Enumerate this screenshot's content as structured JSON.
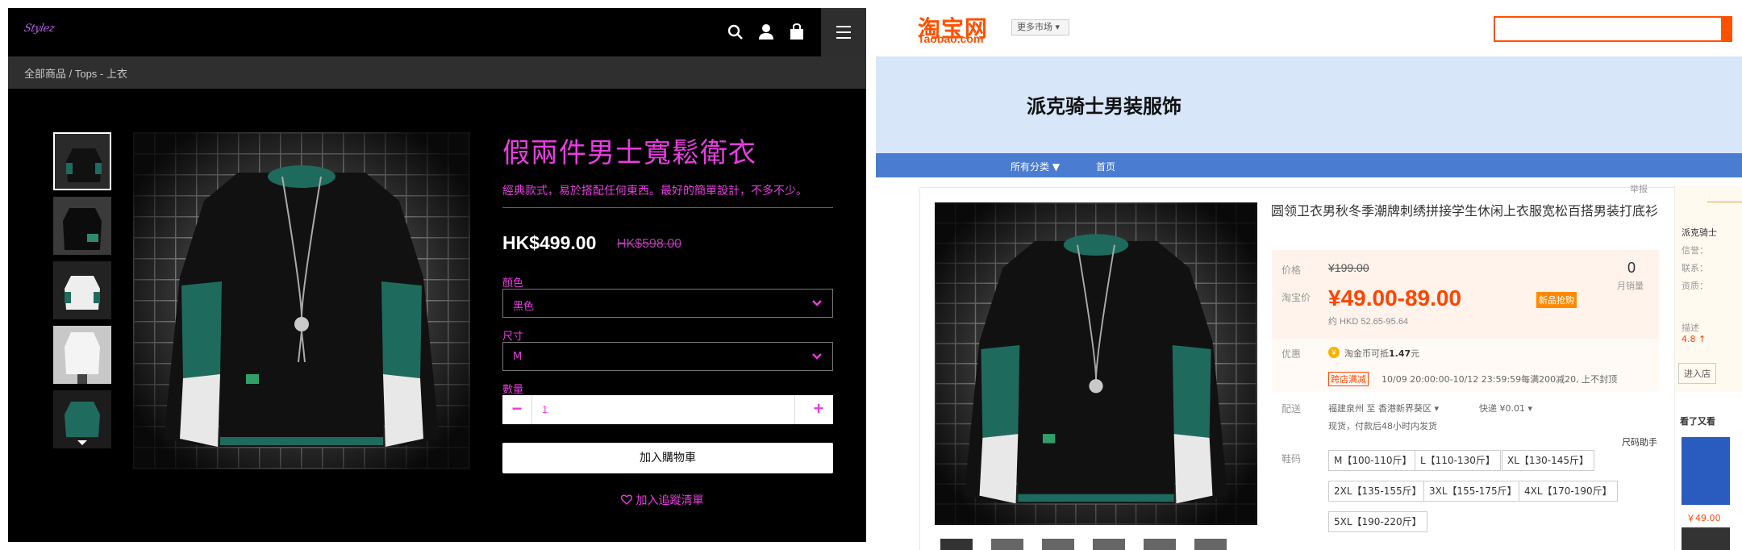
{
  "left": {
    "logo_text": "Stylez",
    "breadcrumb": "全部商品 / Tops - 上衣",
    "product_title": "假兩件男士寬鬆衛衣",
    "product_desc": "經典款式，易於搭配任何東西。最好的簡單設計，不多不少。",
    "price": "HK$499.00",
    "old_price": "HK$598.00",
    "color_label": "顏色",
    "color_value": "黑色",
    "size_label": "尺寸",
    "size_value": "M",
    "qty_label": "數量",
    "qty_value": "1",
    "minus": "−",
    "plus": "+",
    "add_to_cart": "加入購物車",
    "wishlist": "加入追蹤清單",
    "accent": "#e83de0",
    "icons": [
      "search-icon",
      "user-icon",
      "shopping-bag-icon",
      "hamburger-menu-icon"
    ]
  },
  "right": {
    "logo": "淘宝网",
    "logo_sub": "Taobao.com",
    "market": "更多市场",
    "shop_name": "派克骑士男装服饰",
    "nav_all": "所有分类",
    "nav_home": "首页",
    "report": "举报",
    "title": "圆领卫衣男秋冬季潮牌刺绣拼接学生休闲上衣服宽松百搭男装打底衫",
    "price_label": "价格",
    "old_price": "¥199.00",
    "tb_price_label": "淘宝价",
    "price_range": "¥49.00-89.00",
    "badge": "新品抢购",
    "approx": "约 HKD 52.65-95.64",
    "sold_count": "0",
    "sold_label": "月销量",
    "promo_label": "优惠",
    "coin_text": "淘金币可抵",
    "coin_amount": "1.47",
    "coin_unit": "元",
    "store_tag": "跨店满减",
    "promo_time": "10/09 20:00:00-10/12 23:59:59每满200减20, 上不封顶",
    "ship_label": "配送",
    "ship_text": "福建泉州 至 香港新界葵区",
    "ship_fee": "快递 ¥0.01",
    "ship_note": "现货，付款后48小时内发货",
    "size_label": "鞋码",
    "size_helper": "尺码助手",
    "sizes": [
      "M【100-110斤】",
      "L【110-130斤】",
      "XL【130-145斤】",
      "2XL【135-155斤】",
      "3XL【155-175斤】",
      "4XL【170-190斤】",
      "5XL【190-220斤】"
    ],
    "side_shop": "派克骑士",
    "side_credit": "信誉：",
    "side_contact": "联系：",
    "side_qual": "资质：",
    "side_desc": "描述",
    "side_score": "4.8 ↑",
    "side_enter": "进入店",
    "side_more": "看了又看",
    "side_price": "￥49.00",
    "accent": "#ff5000"
  }
}
